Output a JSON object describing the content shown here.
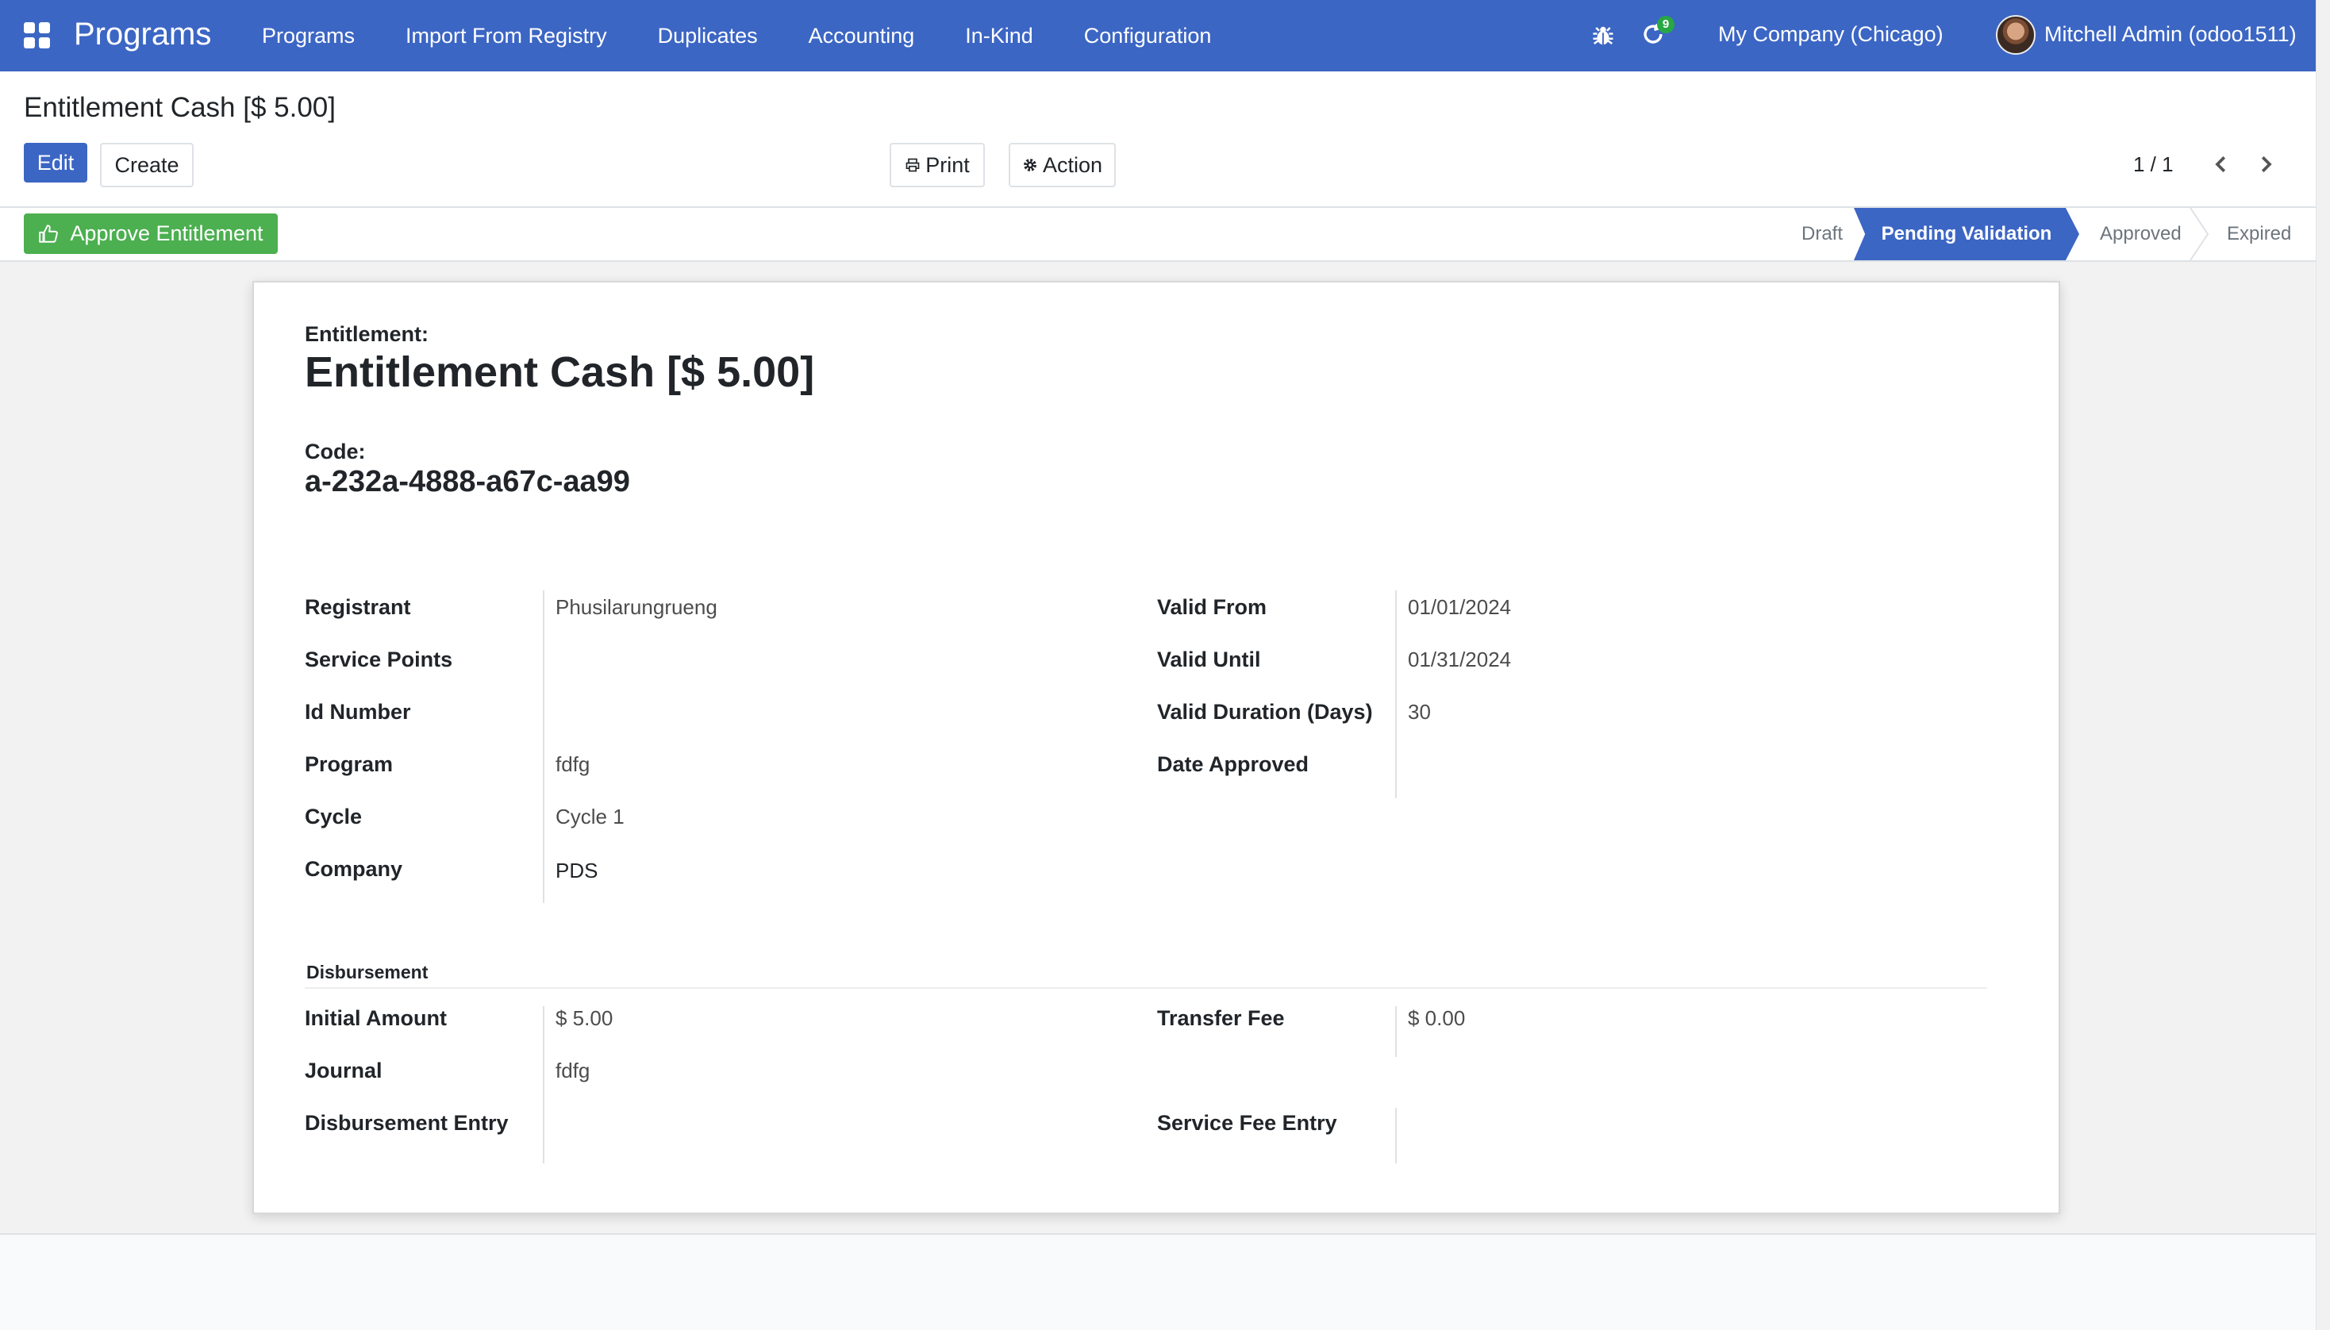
{
  "navbar": {
    "brand": "Programs",
    "menu": [
      "Programs",
      "Import From Registry",
      "Duplicates",
      "Accounting",
      "In-Kind",
      "Configuration"
    ],
    "notification_count": "9",
    "company": "My Company (Chicago)",
    "user": "Mitchell Admin (odoo1511)"
  },
  "control_panel": {
    "breadcrumb": "Entitlement Cash [$ 5.00]",
    "edit_label": "Edit",
    "create_label": "Create",
    "print_label": "Print",
    "action_label": "Action",
    "pager": "1 / 1"
  },
  "statusbar": {
    "approve_label": "Approve Entitlement",
    "stages": [
      "Draft",
      "Pending Validation",
      "Approved",
      "Expired"
    ],
    "active_stage": "Pending Validation"
  },
  "sheet": {
    "entitlement_label": "Entitlement:",
    "title": "Entitlement Cash [$ 5.00]",
    "code_label": "Code:",
    "code": "a-232a-4888-a67c-aa99",
    "left_fields": [
      {
        "label": "Registrant",
        "value": "Phusilarungrueng"
      },
      {
        "label": "Service Points",
        "value": ""
      },
      {
        "label": "Id Number",
        "value": ""
      },
      {
        "label": "Program",
        "value": "fdfg"
      },
      {
        "label": "Cycle",
        "value": "Cycle 1"
      },
      {
        "label": "Company",
        "value": "PDS"
      }
    ],
    "right_fields": [
      {
        "label": "Valid From",
        "value": "01/01/2024"
      },
      {
        "label": "Valid Until",
        "value": "01/31/2024"
      },
      {
        "label": "Valid Duration (Days)",
        "value": "30"
      },
      {
        "label": "Date Approved",
        "value": ""
      }
    ],
    "disbursement_title": "Disbursement",
    "disb_left": [
      {
        "label": "Initial Amount",
        "value": "$ 5.00"
      },
      {
        "label": "Journal",
        "value": "fdfg"
      },
      {
        "label": "Disbursement Entry",
        "value": ""
      }
    ],
    "disb_right": [
      {
        "label": "Transfer Fee",
        "value": "$ 0.00"
      },
      {
        "label": "Service Fee Entry",
        "value": ""
      }
    ]
  },
  "colors": {
    "primary": "#3c66c4",
    "success": "#4caf50"
  }
}
